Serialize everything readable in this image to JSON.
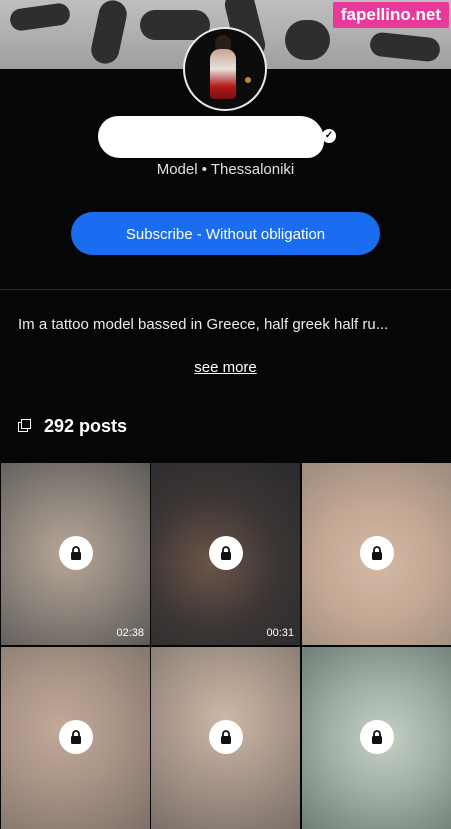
{
  "watermark": "fapellino.net",
  "profile": {
    "subtitle": "Model • Thessaloniki",
    "subscribe_label": "Subscribe - Without obligation",
    "bio": "Im a tattoo model bassed in Greece, half greek half ru...",
    "see_more": "see more",
    "posts_count": "292 posts"
  },
  "grid": {
    "tiles": [
      {
        "duration": "02:38"
      },
      {
        "duration": "00:31"
      },
      {
        "duration": ""
      },
      {
        "duration": ""
      },
      {
        "duration": ""
      },
      {
        "duration": ""
      }
    ]
  }
}
